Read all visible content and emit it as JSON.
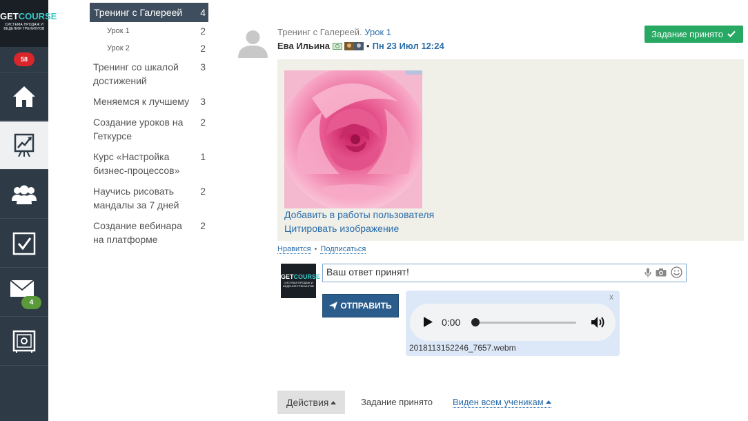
{
  "sidebar": {
    "logo": {
      "brand_a": "GET",
      "brand_b": "COURSE",
      "tagline": "СИСТЕМА ПРОДАЖ И ВЕДЕНИЯ ТРЕНИНГОВ"
    },
    "notifications_badge": "58",
    "items": [
      {
        "icon": "home-icon"
      },
      {
        "icon": "chart-board-icon",
        "active": true
      },
      {
        "icon": "users-icon"
      },
      {
        "icon": "checkbox-icon"
      },
      {
        "icon": "mail-icon",
        "badge": "4"
      },
      {
        "icon": "safe-icon"
      }
    ]
  },
  "lessons": [
    {
      "title": "Тренинг с Галереей",
      "count": "4",
      "active": true
    },
    {
      "title": "Урок 1",
      "count": "2",
      "sub": true
    },
    {
      "title": "Урок 2",
      "count": "2",
      "sub": true
    },
    {
      "title": "Тренинг со шкалой достижений",
      "count": "3"
    },
    {
      "title": "Меняемся к лучшему",
      "count": "3"
    },
    {
      "title": "Создание уроков на Геткурсе",
      "count": "2"
    },
    {
      "title": "Курс «Настройка бизнес-процессов»",
      "count": "1"
    },
    {
      "title": "Научись рисовать мандалы за 7 дней",
      "count": "2"
    },
    {
      "title": "Создание вебинара на платформе",
      "count": "2"
    }
  ],
  "post": {
    "training": "Тренинг с Галереей.",
    "lesson_link": "Урок 1",
    "author": "Ева Ильина",
    "separator": "•",
    "date": "Пн 23 Июл 12:24",
    "status_button": "Задание принято",
    "links": {
      "add_to_works": "Добавить в работы пользователя",
      "quote_image": "Цитировать изображение"
    },
    "like": "Нравится",
    "subscribe": "Подписаться",
    "dot": "•"
  },
  "reply": {
    "logo": {
      "brand_a": "GET",
      "brand_b": "COURSE",
      "tagline": "СИСТЕМА ПРОДАЖ И ВЕДЕНИЯ ТРЕНИНГОВ"
    },
    "input_value": "Ваш ответ принят!",
    "send_label": "ОТПРАВИТЬ",
    "audio": {
      "close": "x",
      "time": "0:00",
      "progress": 0,
      "filename": "2018113152246_7657.webm"
    }
  },
  "footer": {
    "actions_label": "Действия",
    "status_text": "Задание принято",
    "visibility_label": "Виден всем ученикам"
  },
  "colors": {
    "sidebar_bg": "#2e3a46",
    "accent_green": "#27a863",
    "link_blue": "#2a6da9",
    "send_btn": "#2b5d8c"
  }
}
